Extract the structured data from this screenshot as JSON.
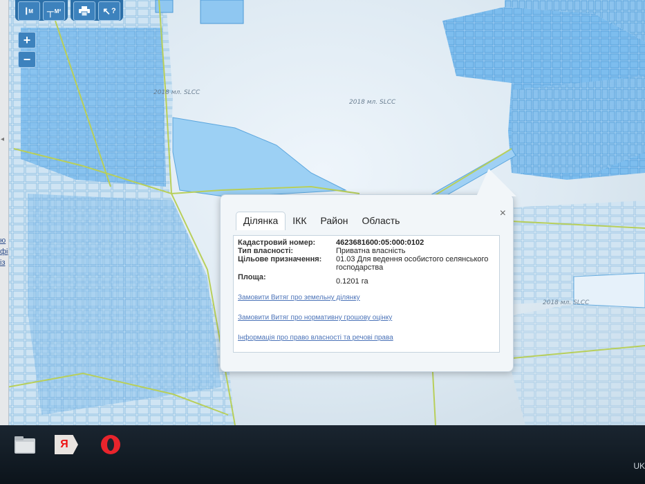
{
  "toolbar": {
    "buttons": [
      {
        "icon": "measure-length-icon",
        "label": "M"
      },
      {
        "icon": "measure-area-icon",
        "label": "M²"
      },
      {
        "icon": "print-icon",
        "label": ""
      },
      {
        "icon": "cursor-help-icon",
        "label": "?"
      }
    ]
  },
  "zoom": {
    "in_label": "+",
    "out_label": "−"
  },
  "map_labels": [
    "2018 мл. SLCC",
    "2018 мл. SLCC",
    "2018 мл. SLCC"
  ],
  "side_panel": {
    "fragments": [
      "ю",
      "фі",
      "із"
    ]
  },
  "popup": {
    "tabs": [
      "Ділянка",
      "ІКК",
      "Район",
      "Область"
    ],
    "close_label": "×",
    "fields": [
      {
        "label": "Кадастровий номер:",
        "value": "4623681600:05:000:0102"
      },
      {
        "label": "Тип власності:",
        "value": "Приватна власність"
      },
      {
        "label": "Цільове призначення:",
        "value": "01.03 Для ведення особистого селянського господарства"
      },
      {
        "label": "Площа:",
        "value": "0.1201 га"
      }
    ],
    "links": [
      "Замовити Витяг про земельну ділянку",
      "Замовити Витяг про нормативну грошову оцінку",
      "Інформація про право власності та речові права"
    ]
  },
  "taskbar": {
    "items": [
      {
        "icon": "file-explorer-icon",
        "label": ""
      },
      {
        "icon": "yandex-browser-icon",
        "label": "Я"
      },
      {
        "icon": "opera-browser-icon",
        "label": ""
      }
    ],
    "language": "UK"
  }
}
